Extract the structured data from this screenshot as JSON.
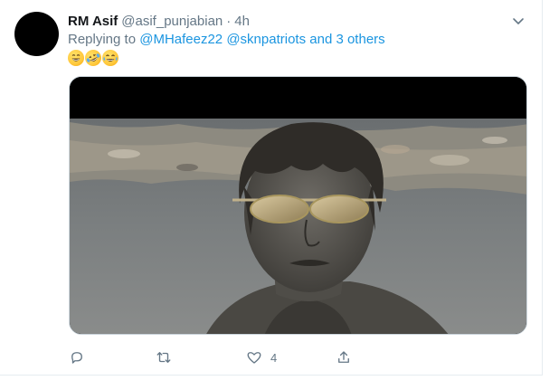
{
  "tweet": {
    "display_name": "RM Asif",
    "handle": "@asif_punjabian",
    "separator": "·",
    "time": "4h",
    "reply": {
      "prefix": "Replying to ",
      "mention_1": "@MHafeez22",
      "mention_2": "@sknpatriots",
      "others": "and 3 others"
    },
    "emojis": [
      "grinning-face-icon",
      "rolling-laughing-icon",
      "tears-of-joy-icon"
    ],
    "media": {
      "description_icon": "photo-of-man-with-sunglasses-covered-in-mud"
    },
    "actions": {
      "reply_count": "",
      "retweet_count": "",
      "like_count": "4",
      "share_count": ""
    }
  },
  "colors": {
    "text": "#14171a",
    "secondary": "#657786",
    "link": "#1b95e0",
    "border": "#e6ecf0"
  }
}
